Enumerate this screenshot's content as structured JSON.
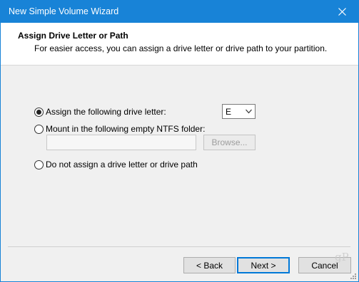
{
  "window": {
    "title": "New Simple Volume Wizard",
    "close_icon": "close-icon",
    "accent_color": "#1883d7"
  },
  "header": {
    "heading": "Assign Drive Letter or Path",
    "subheading": "For easier access, you can assign a drive letter or drive path to your partition."
  },
  "options": {
    "assign_letter": {
      "label": "Assign the following drive letter:",
      "checked": true
    },
    "mount_folder": {
      "label": "Mount in the following empty NTFS folder:",
      "checked": false
    },
    "no_assign": {
      "label": "Do not assign a drive letter or drive path",
      "checked": false
    }
  },
  "drive_letter_select": {
    "value": "E"
  },
  "folder_path_input": {
    "value": ""
  },
  "browse_button": {
    "label": "Browse..."
  },
  "buttons": {
    "back": "< Back",
    "next": "Next >",
    "cancel": "Cancel"
  },
  "watermark": {
    "text": "gP"
  }
}
